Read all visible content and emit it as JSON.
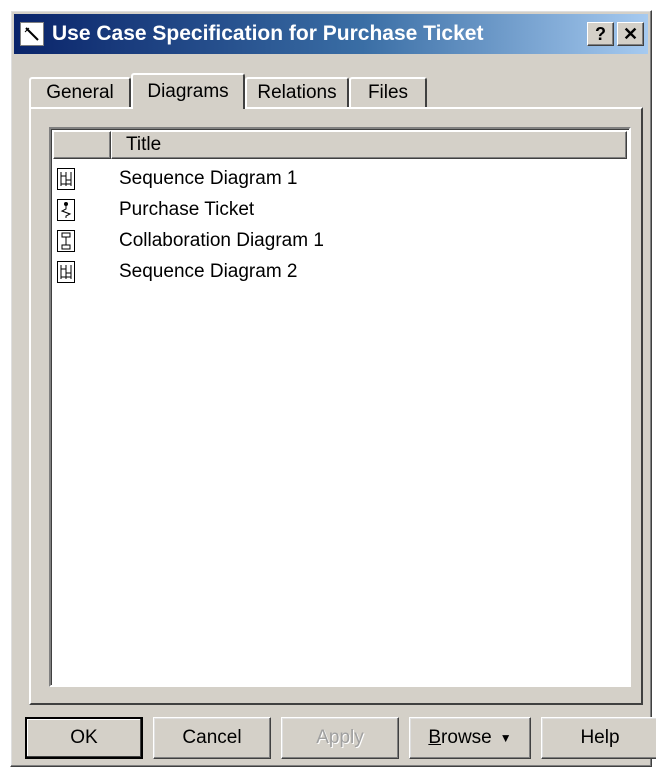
{
  "window": {
    "title": "Use Case Specification for Purchase Ticket",
    "help_glyph": "?",
    "close_glyph": "✕"
  },
  "tabs": [
    {
      "label": "General"
    },
    {
      "label": "Diagrams",
      "active": true
    },
    {
      "label": "Relations"
    },
    {
      "label": "Files"
    }
  ],
  "list": {
    "column_title": "Title",
    "items": [
      {
        "label": "Sequence Diagram 1",
        "icon": "sequence-diagram-icon"
      },
      {
        "label": "Purchase Ticket",
        "icon": "activity-diagram-icon"
      },
      {
        "label": "Collaboration Diagram 1",
        "icon": "collaboration-diagram-icon"
      },
      {
        "label": "Sequence Diagram 2",
        "icon": "sequence-diagram-icon"
      }
    ]
  },
  "buttons": {
    "ok": "OK",
    "cancel": "Cancel",
    "apply": "Apply",
    "browse_first": "B",
    "browse_rest": "rowse",
    "browse_caret": "▼",
    "help": "Help"
  },
  "colors": {
    "dialog_bg": "#d4d0c8",
    "title_start": "#0a246a",
    "title_end": "#a6caf0"
  }
}
